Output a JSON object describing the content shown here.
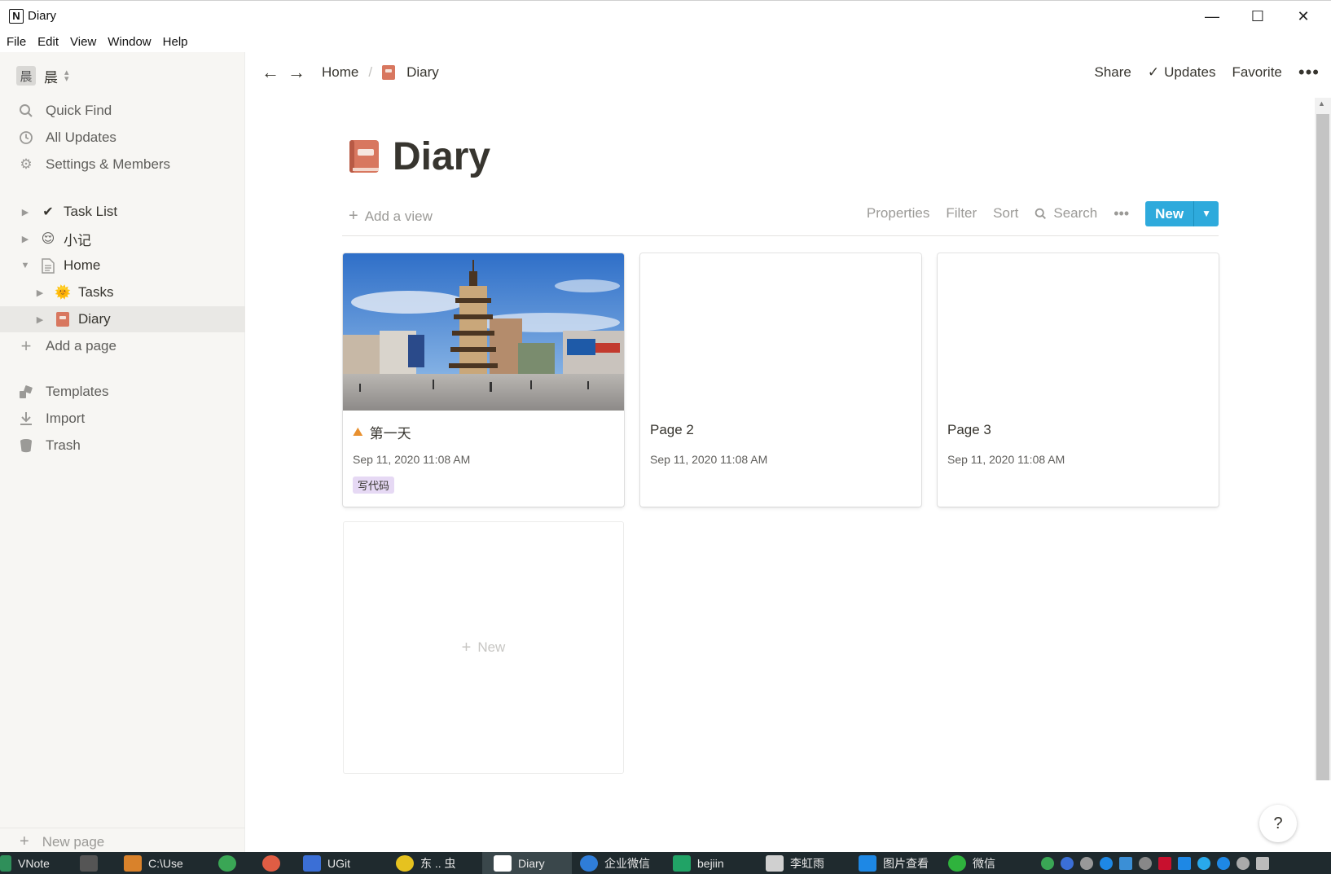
{
  "window": {
    "title": "Diary",
    "app_icon": "N"
  },
  "menu": [
    "File",
    "Edit",
    "View",
    "Window",
    "Help"
  ],
  "sidebar": {
    "workspace_avatar": "晨",
    "workspace_name": "晨",
    "nav": [
      {
        "label": "Quick Find",
        "icon": "search-icon"
      },
      {
        "label": "All Updates",
        "icon": "clock-icon"
      },
      {
        "label": "Settings & Members",
        "icon": "gear-icon"
      }
    ],
    "pages": [
      {
        "label": "Task List",
        "icon": "✔"
      },
      {
        "label": "小记",
        "icon": "😌"
      },
      {
        "label": "Home",
        "icon": "page-icon"
      },
      {
        "label": "Tasks",
        "icon": "🌞"
      },
      {
        "label": "Diary",
        "icon": "book-icon"
      }
    ],
    "add_page": "Add a page",
    "bottom": [
      {
        "label": "Templates",
        "icon": "templates-icon"
      },
      {
        "label": "Import",
        "icon": "import-icon"
      },
      {
        "label": "Trash",
        "icon": "trash-icon"
      }
    ],
    "new_page": "New page"
  },
  "topbar": {
    "breadcrumb_home": "Home",
    "breadcrumb_sep": "/",
    "breadcrumb_current": "Diary",
    "share": "Share",
    "updates": "Updates",
    "favorite": "Favorite",
    "more": "•••"
  },
  "page": {
    "title": "Diary"
  },
  "view_bar": {
    "add_view": "Add a view",
    "properties": "Properties",
    "filter": "Filter",
    "sort": "Sort",
    "search": "Search",
    "more": "•••",
    "new": "New"
  },
  "cards": [
    {
      "title": "第一天",
      "icon": "⛰",
      "date": "Sep 11, 2020 11:08 AM",
      "tag": "写代码",
      "has_cover": true
    },
    {
      "title": "Page 2",
      "date": "Sep 11, 2020 11:08 AM"
    },
    {
      "title": "Page 3",
      "date": "Sep 11, 2020 11:08 AM"
    }
  ],
  "new_card_label": "New",
  "help": "?",
  "taskbar": [
    {
      "label": "VNote",
      "color": "#2f8f5a"
    },
    {
      "label": "",
      "color": "#555"
    },
    {
      "label": "C:\\Use",
      "color": "#d9822b"
    },
    {
      "label": "",
      "color": "#3aa655"
    },
    {
      "label": "",
      "color": "#e05d44"
    },
    {
      "label": "UGit",
      "color": "#3b6fd6"
    },
    {
      "label": "东 .. 虫",
      "color": "#e6c21f"
    },
    {
      "label": "Diary",
      "color": "#ffffff"
    },
    {
      "label": "企业微信",
      "color": "#2f7dd8"
    },
    {
      "label": "bejiin",
      "color": "#21a366"
    },
    {
      "label": "李虹雨",
      "color": "#d0d0d0"
    },
    {
      "label": "图片查看",
      "color": "#1e88e5"
    },
    {
      "label": "微信",
      "color": "#2fb33d"
    }
  ]
}
